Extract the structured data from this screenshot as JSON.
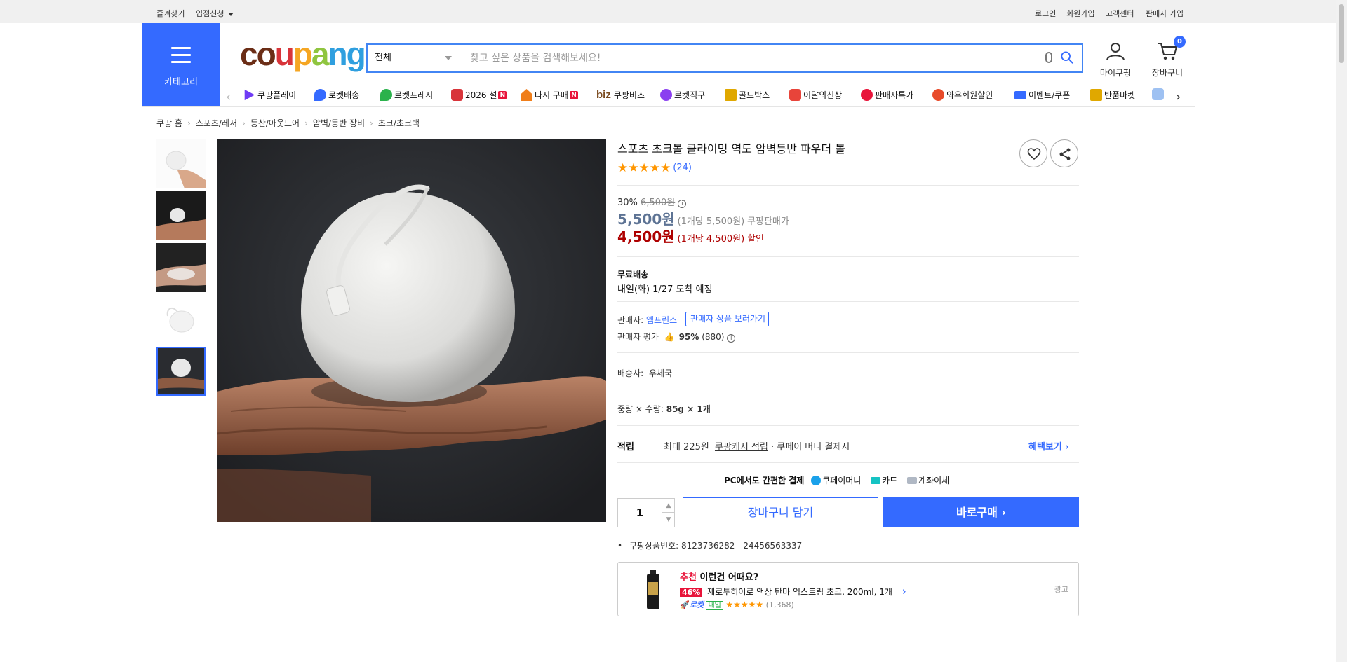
{
  "topbar": {
    "bookmark": "즐겨찾기",
    "partner": "입점신청",
    "login": "로그인",
    "signup": "회원가입",
    "cs": "고객센터",
    "seller_signup": "판매자 가입"
  },
  "header": {
    "category_label": "카테고리",
    "logo": [
      "c",
      "o",
      "u",
      "p",
      "a",
      "n",
      "g"
    ],
    "search_category": "전체",
    "search_placeholder": "찾고 싶은 상품을 검색해보세요!",
    "mypage": "마이쿠팡",
    "cart": "장바구니",
    "cart_count": "0"
  },
  "nav": [
    {
      "label": "쿠팡플레이",
      "icon": "play-icon",
      "color": "#6f3bf5"
    },
    {
      "label": "로켓배송",
      "icon": "rocket-icon",
      "color": "#346aff"
    },
    {
      "label": "로켓프레시",
      "icon": "rocket-fresh-icon",
      "color": "#2bb24c"
    },
    {
      "label": "2026 설",
      "icon": "gift-icon",
      "color": "#d8343a",
      "badge": "N"
    },
    {
      "label": "다시 구매",
      "icon": "house-icon",
      "color": "#f07e1a",
      "badge": "N"
    },
    {
      "label": "쿠팡비즈",
      "icon": "biz-icon",
      "color": "#7a4a1e",
      "prefix": "biz"
    },
    {
      "label": "로켓직구",
      "icon": "global-rocket-icon",
      "color": "#8a3ff0"
    },
    {
      "label": "골드박스",
      "icon": "goldbox-icon",
      "color": "#e0a800"
    },
    {
      "label": "이달의신상",
      "icon": "new-icon",
      "color": "#e8443a"
    },
    {
      "label": "판매자특가",
      "icon": "percent-icon",
      "color": "#e8143a"
    },
    {
      "label": "와우회원할인",
      "icon": "wow-icon",
      "color": "#e84b2a"
    },
    {
      "label": "이벤트/쿠폰",
      "icon": "coupon-icon",
      "color": "#346aff"
    },
    {
      "label": "반품마켓",
      "icon": "market-icon",
      "color": "#e0a800"
    }
  ],
  "breadcrumb": [
    "쿠팡 홈",
    "스포츠/레저",
    "등산/아웃도어",
    "암벽/등반 장비",
    "초크/초크백"
  ],
  "product": {
    "title": "스포츠 초크볼 클라이밍 역도 암벽등반 파우더 볼",
    "rating": 5,
    "review_count": "(24)",
    "discount_rate": "30%",
    "original_price": "6,500원",
    "price": "5,500원",
    "unit_price": "(1개당 5,500원)",
    "price_label": "쿠팡판매가",
    "sale_price": "4,500원",
    "sale_unit_price": "(1개당 4,500원)",
    "sale_label": "할인",
    "shipping_title": "무료배송",
    "shipping_eta": "내일(화) 1/27 도착 예정",
    "seller_label": "판매자:",
    "seller_name": "엠프린스",
    "seller_button": "판매자 상품 보러가기",
    "seller_rating_label": "판매자 평가",
    "seller_rating": "95%",
    "seller_rating_count": "(880)",
    "carrier_label": "배송사:",
    "carrier": "우체국",
    "option_label": "중량 × 수량:",
    "option_value": "85g × 1개",
    "reward_title": "적립",
    "reward_text_1": "최대 225원",
    "reward_link": "쿠팡캐시 적립",
    "reward_text_2": "· 쿠페이 머니 결제시",
    "benefit_link": "혜택보기",
    "pay_title": "PC에서도 간편한 결제",
    "pay_methods": [
      "쿠페이머니",
      "카드",
      "계좌이체"
    ],
    "quantity": "1",
    "add_to_cart": "장바구니 담기",
    "buy_now": "바로구매",
    "product_no_label": "쿠팡상품번호:",
    "product_no": "8123736282 - 24456563337"
  },
  "recommend": {
    "tag": "추천",
    "title": "이런건 어때요?",
    "discount": "46%",
    "name": "제로투히어로 액상 탄마 익스트림 초크, 200ml, 1개",
    "rocket": "로켓",
    "delivery": "내일",
    "reviews": "(1,368)",
    "ad": "광고"
  },
  "colors": {
    "brand": "#346aff",
    "sale": "#ae0000",
    "star": "#ff9600"
  }
}
